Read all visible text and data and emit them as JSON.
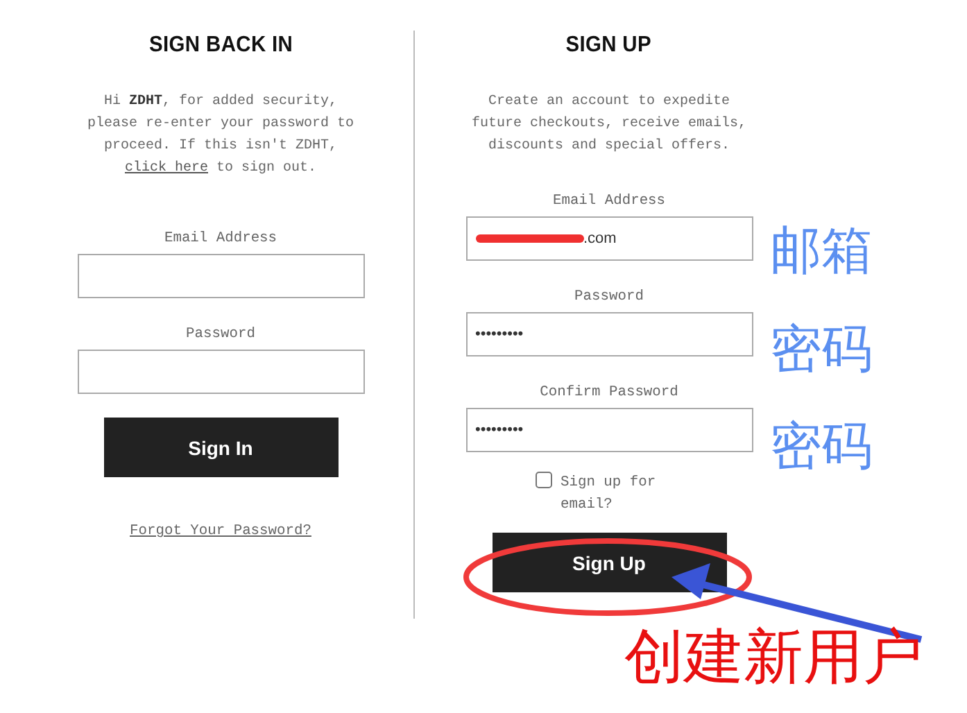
{
  "sign_in": {
    "title": "SIGN BACK IN",
    "intro": "Hi **ZDHT**, for added security, please re-enter your password to proceed. If this isn't ZDHT,",
    "link": "click here",
    "intro_end": " to sign out.",
    "fields": [
      {
        "label": "Email Address"
      },
      {
        "label": "Password"
      }
    ],
    "button": "Sign In",
    "forgot": "Forgot Your Password?"
  },
  "sign_up": {
    "title": "SIGN UP",
    "intro": "Create an account to expedite future checkouts, receive emails, discounts and special offers.",
    "fields": [
      {
        "label": "Email Address",
        "value": ".com",
        "redacted": true
      },
      {
        "label": "Password",
        "value": "•••••••••",
        "redacted": false
      },
      {
        "label": "Confirm Password",
        "value": "•••••••••",
        "redacted": false
      }
    ],
    "newsletter": {
      "label": "Sign up for email?",
      "checked": false
    },
    "button": "Sign Up"
  },
  "annotations": {
    "labels": [
      "邮箱",
      "密码",
      "密码"
    ],
    "caption": "创建新用户"
  }
}
